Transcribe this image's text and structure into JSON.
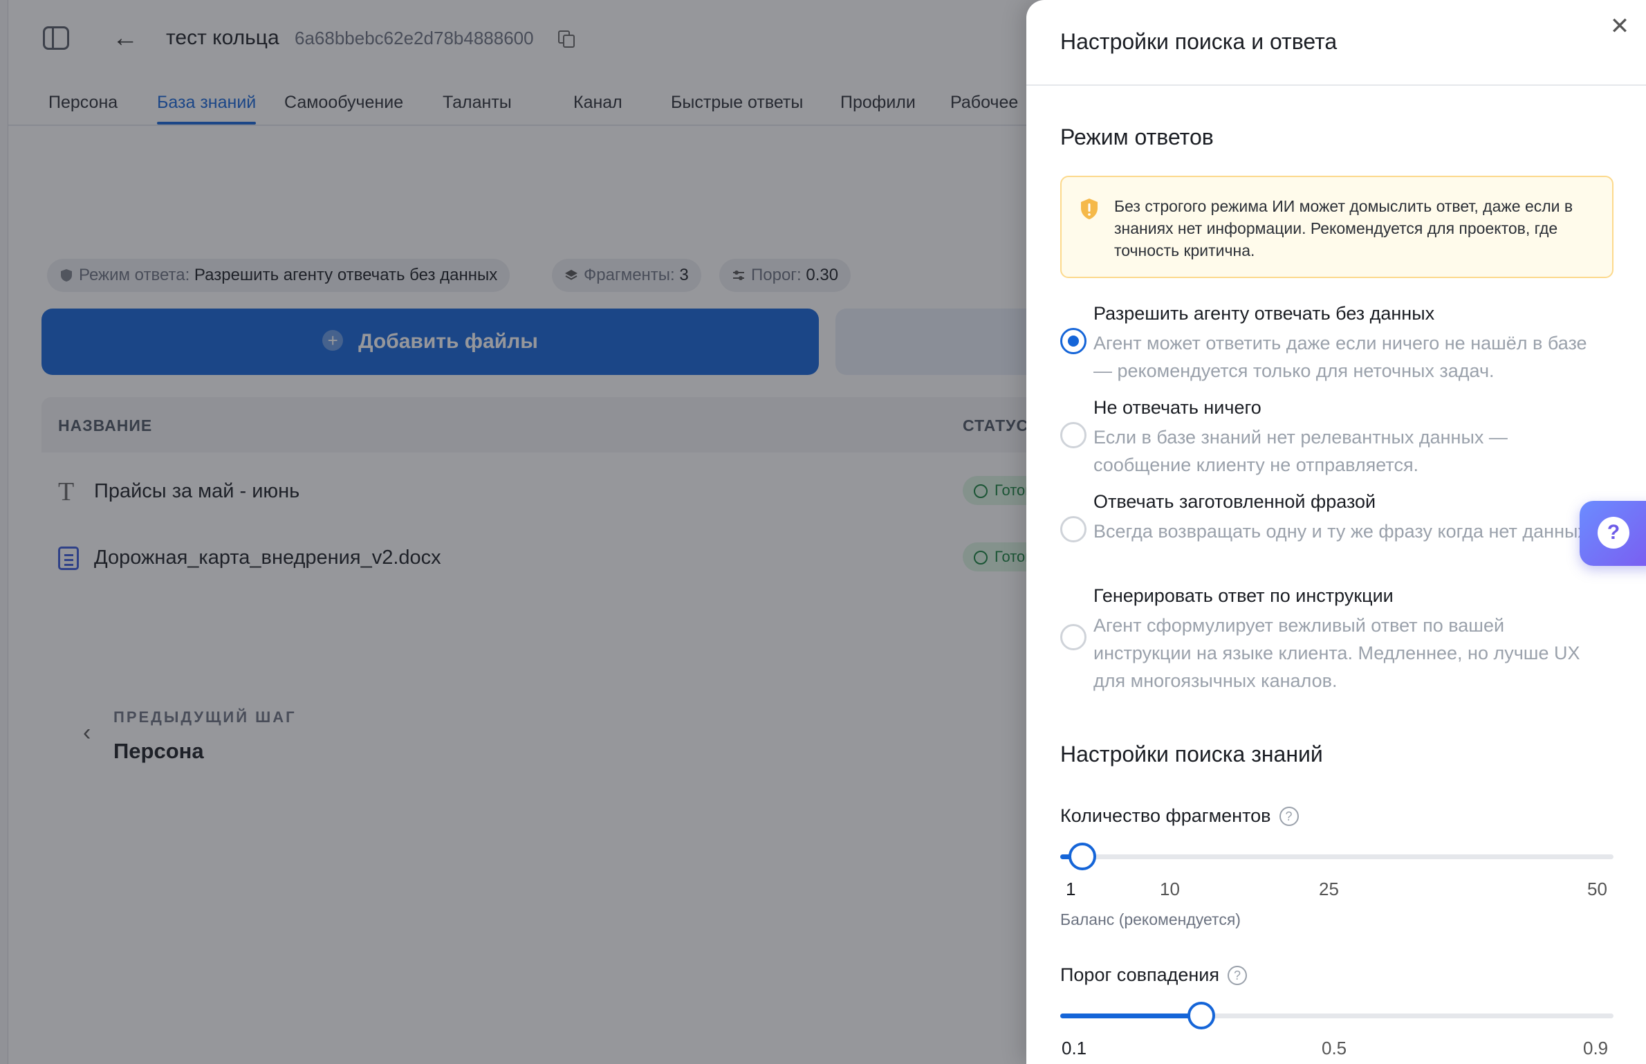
{
  "header": {
    "project_name": "тест кольца",
    "project_id": "6a68bbebc62e2d78b4888600"
  },
  "tabs": [
    {
      "label": "Персона"
    },
    {
      "label": "База знаний",
      "active": true
    },
    {
      "label": "Самообучение"
    },
    {
      "label": "Таланты"
    },
    {
      "label": "Канал"
    },
    {
      "label": "Быстрые ответы"
    },
    {
      "label": "Профили"
    },
    {
      "label": "Рабочее"
    }
  ],
  "chips": {
    "mode_label": "Режим ответа:",
    "mode_value": "Разрешить агенту отвечать без данных",
    "fragments_label": "Фрагменты:",
    "fragments_value": "3",
    "threshold_label": "Порог:",
    "threshold_value": "0.30"
  },
  "actions": {
    "add_files": "Добавить файлы"
  },
  "table": {
    "columns": [
      "НАЗВАНИЕ",
      "СТАТУС"
    ],
    "rows": [
      {
        "name": "Прайсы за май - июнь",
        "status": "Готово",
        "icon": "text-icon"
      },
      {
        "name": "Дорожная_карта_внедрения_v2.docx",
        "status": "Готово",
        "icon": "document-icon"
      }
    ]
  },
  "prev_step": {
    "label": "ПРЕДЫДУЩИЙ ШАГ",
    "title": "Персона"
  },
  "drawer": {
    "title": "Настройки поиска и ответа",
    "answer_mode": {
      "heading": "Режим ответов",
      "warning": "Без строгого режима ИИ может домыслить ответ, даже если в знаниях нет информации. Рекомендуется для проектов, где точность критична.",
      "options": [
        {
          "title": "Разрешить агенту отвечать без данных",
          "description": "Агент может ответить даже если ничего не нашёл в базе — рекомендуется только для неточных задач.",
          "checked": true
        },
        {
          "title": "Не отвечать ничего",
          "description": "Если в базе знаний нет релевантных данных — сообщение клиенту не отправляется.",
          "checked": false
        },
        {
          "title": "Отвечать заготовленной фразой",
          "description": "Всегда возвращать одну и ту же фразу когда нет данных.",
          "checked": false
        },
        {
          "title": "Генерировать ответ по инструкции",
          "description": "Агент сформулирует вежливый ответ по вашей инструкции на языке клиента. Медленнее, но лучше UX для многоязычных каналов.",
          "checked": false
        }
      ]
    },
    "search": {
      "heading": "Настройки поиска знаний",
      "fragments": {
        "label": "Количество фрагментов",
        "value": 3,
        "min": 1,
        "max": 50,
        "ticks": [
          "1",
          "10",
          "25",
          "50"
        ],
        "hint": "Баланс (рекомендуется)"
      },
      "threshold": {
        "label": "Порог совпадения",
        "value": 0.3,
        "min": 0.1,
        "max": 0.9,
        "ticks": [
          "0.1",
          "0.5",
          "0.9"
        ]
      }
    }
  },
  "colors": {
    "accent": "#1565d8",
    "warning_bg": "#fffbeb",
    "warning_border": "#fcd98c",
    "success": "#15803d"
  }
}
